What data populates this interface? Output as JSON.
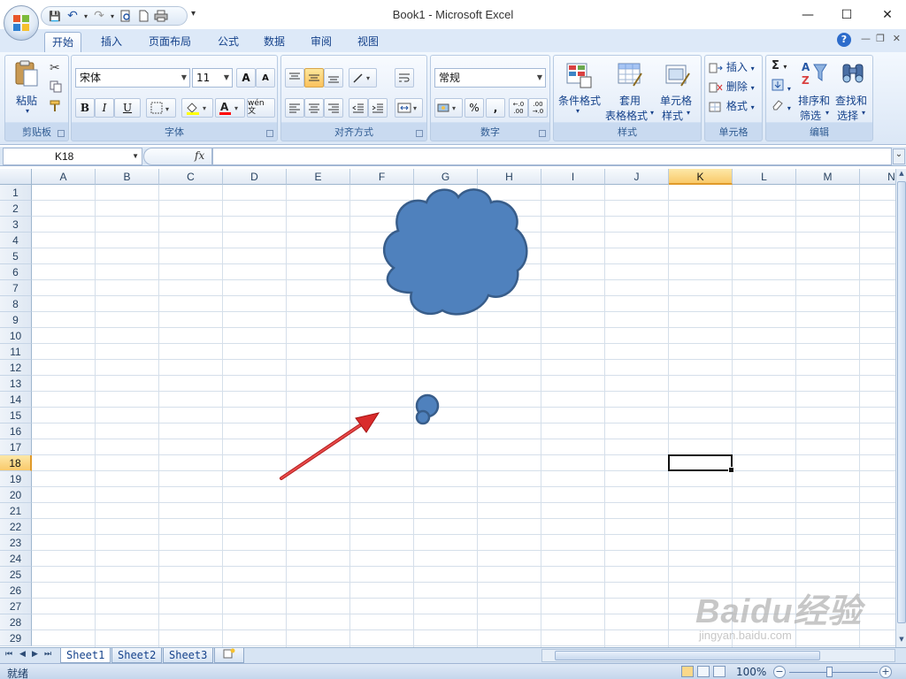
{
  "window": {
    "title": "Book1 - Microsoft Excel",
    "minimize": "—",
    "maximize": "☐",
    "close": "✕"
  },
  "quick_access": {
    "save": "💾",
    "undo": "↶",
    "redo": "↷",
    "more": "▾"
  },
  "tabs": [
    {
      "label": "开始"
    },
    {
      "label": "插入"
    },
    {
      "label": "页面布局"
    },
    {
      "label": "公式"
    },
    {
      "label": "数据"
    },
    {
      "label": "审阅"
    },
    {
      "label": "视图"
    }
  ],
  "active_tab": "开始",
  "help_label": "?",
  "ribbon": {
    "clipboard": {
      "label": "剪贴板",
      "paste": "粘贴"
    },
    "font": {
      "label": "字体",
      "font_name": "宋体",
      "font_size": "11",
      "grow": "A",
      "shrink": "A",
      "bold": "B",
      "italic": "I",
      "underline": "U",
      "phonetic": "wén 文"
    },
    "alignment": {
      "label": "对齐方式"
    },
    "number": {
      "label": "数字",
      "format": "常规",
      "percent": "%",
      "comma": ",",
      "inc_decimal": "←.0 .00",
      "dec_decimal": ".00 →.0"
    },
    "styles": {
      "label": "样式",
      "conditional": "条件格式",
      "table_line1": "套用",
      "table_line2": "表格格式",
      "cell_line1": "单元格",
      "cell_line2": "样式"
    },
    "cells": {
      "label": "单元格",
      "insert": "插入",
      "delete": "删除",
      "format": "格式"
    },
    "editing": {
      "label": "编辑",
      "sort_line1": "排序和",
      "sort_line2": "筛选",
      "find_line1": "查找和",
      "find_line2": "选择"
    }
  },
  "formula_bar": {
    "name_box": "K18",
    "fx": "fx",
    "content": ""
  },
  "grid": {
    "columns": [
      "A",
      "B",
      "C",
      "D",
      "E",
      "F",
      "G",
      "H",
      "I",
      "J",
      "K",
      "L",
      "M",
      "N"
    ],
    "rows": [
      "1",
      "2",
      "3",
      "4",
      "5",
      "6",
      "7",
      "8",
      "9",
      "10",
      "11",
      "12",
      "13",
      "14",
      "15",
      "16",
      "17",
      "18",
      "19",
      "20",
      "21",
      "22",
      "23",
      "24",
      "25",
      "26",
      "27",
      "28",
      "29"
    ],
    "selected_column": "K",
    "selected_row": "18"
  },
  "sheets": [
    {
      "label": "Sheet1"
    },
    {
      "label": "Sheet2"
    },
    {
      "label": "Sheet3"
    }
  ],
  "active_sheet": "Sheet1",
  "status": {
    "ready": "就绪",
    "zoom": "100%",
    "zoom_minus": "−",
    "zoom_plus": "+"
  },
  "watermark": {
    "brand": "Baidu经验",
    "url": "jingyan.baidu.com"
  },
  "colors": {
    "shape_fill": "#4f81bd",
    "shape_stroke": "#385d8a",
    "arrow": "#d92b2b",
    "selection_header": "#f9c96a"
  }
}
